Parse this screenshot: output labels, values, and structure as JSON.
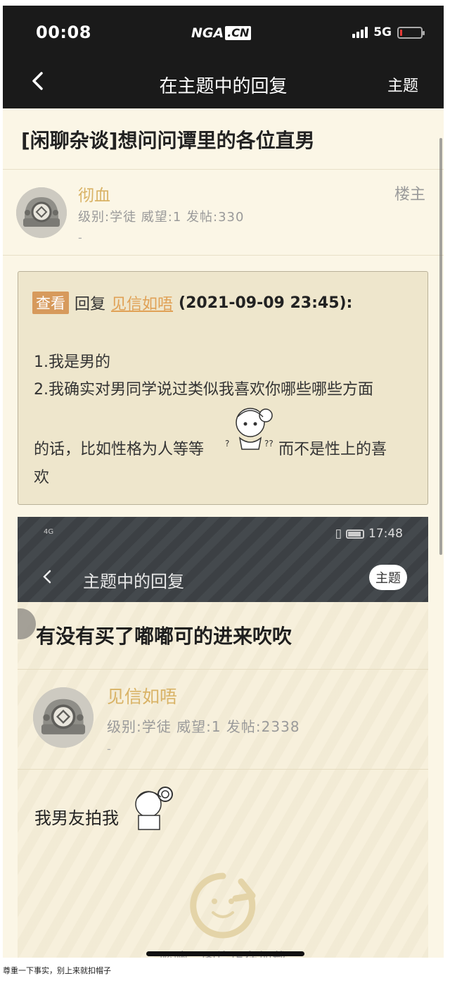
{
  "status_bar": {
    "time": "00:08",
    "logo_left": "NGA",
    "logo_right": ".CN",
    "network": "5G"
  },
  "nav": {
    "title": "在主题中的回复",
    "topic_button": "主题"
  },
  "thread": {
    "title": "[闲聊杂谈]想问问谭里的各位直男"
  },
  "post": {
    "author": "彻血",
    "meta": "级别:学徒  威望:1  发帖:330",
    "dash": "-",
    "floor": "楼主",
    "quote": {
      "view_label": "查看",
      "reply_label": "回复",
      "user": "见信如唔",
      "date": "(2021-09-09 23:45):"
    },
    "lines": [
      "1.我是男的",
      "2.我确实对男同学说过类似我喜欢你哪些哪些方面",
      "的话，比如性格为人等等",
      "而不是性上的喜",
      "欢"
    ]
  },
  "screenshot": {
    "status_sig": "4G",
    "status_time": "17:48",
    "title": "主题中的回复",
    "topic_button": "主题",
    "thread_title": "有没有买了嘟嘟可的进来吹吹",
    "author": "见信如唔",
    "meta": "级别:学徒   威望:1   发帖:2338",
    "dash": "-",
    "body": "我男友拍我",
    "loading_text": "喔噢，图片正在加载"
  },
  "caption": "尊重一下事实，别上来就扣帽子"
}
